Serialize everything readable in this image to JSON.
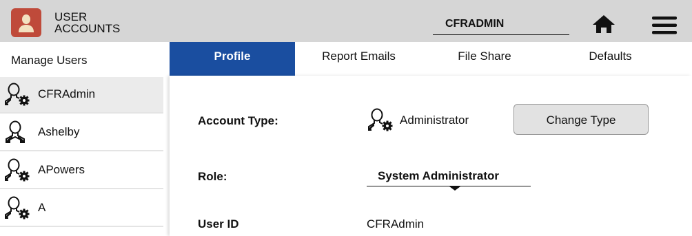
{
  "header": {
    "app_title": "USER ACCOUNTS",
    "current_user": "CFRADMIN",
    "icon": "user-accounts-icon",
    "home_icon": "home-icon",
    "menu_icon": "hamburger-menu-icon",
    "accent_color": "#bf4a3a"
  },
  "sidebar": {
    "title": "Manage Users",
    "items": [
      {
        "label": "CFRAdmin",
        "icon": "admin-user-icon",
        "selected": true
      },
      {
        "label": "Ashelby",
        "icon": "user-icon",
        "selected": false
      },
      {
        "label": "APowers",
        "icon": "admin-user-icon",
        "selected": false
      },
      {
        "label": "A",
        "icon": "admin-user-icon",
        "selected": false
      }
    ]
  },
  "tabs": [
    {
      "label": "Profile",
      "active": true
    },
    {
      "label": "Report Emails",
      "active": false
    },
    {
      "label": "File Share",
      "active": false
    },
    {
      "label": "Defaults",
      "active": false
    }
  ],
  "tab_active_color": "#1a4ea0",
  "profile": {
    "account_type_label": "Account Type:",
    "account_type_value": "Administrator",
    "change_type_button": "Change Type",
    "role_label": "Role:",
    "role_value": "System Administrator",
    "user_id_label": "User ID",
    "user_id_value": "CFRAdmin"
  }
}
